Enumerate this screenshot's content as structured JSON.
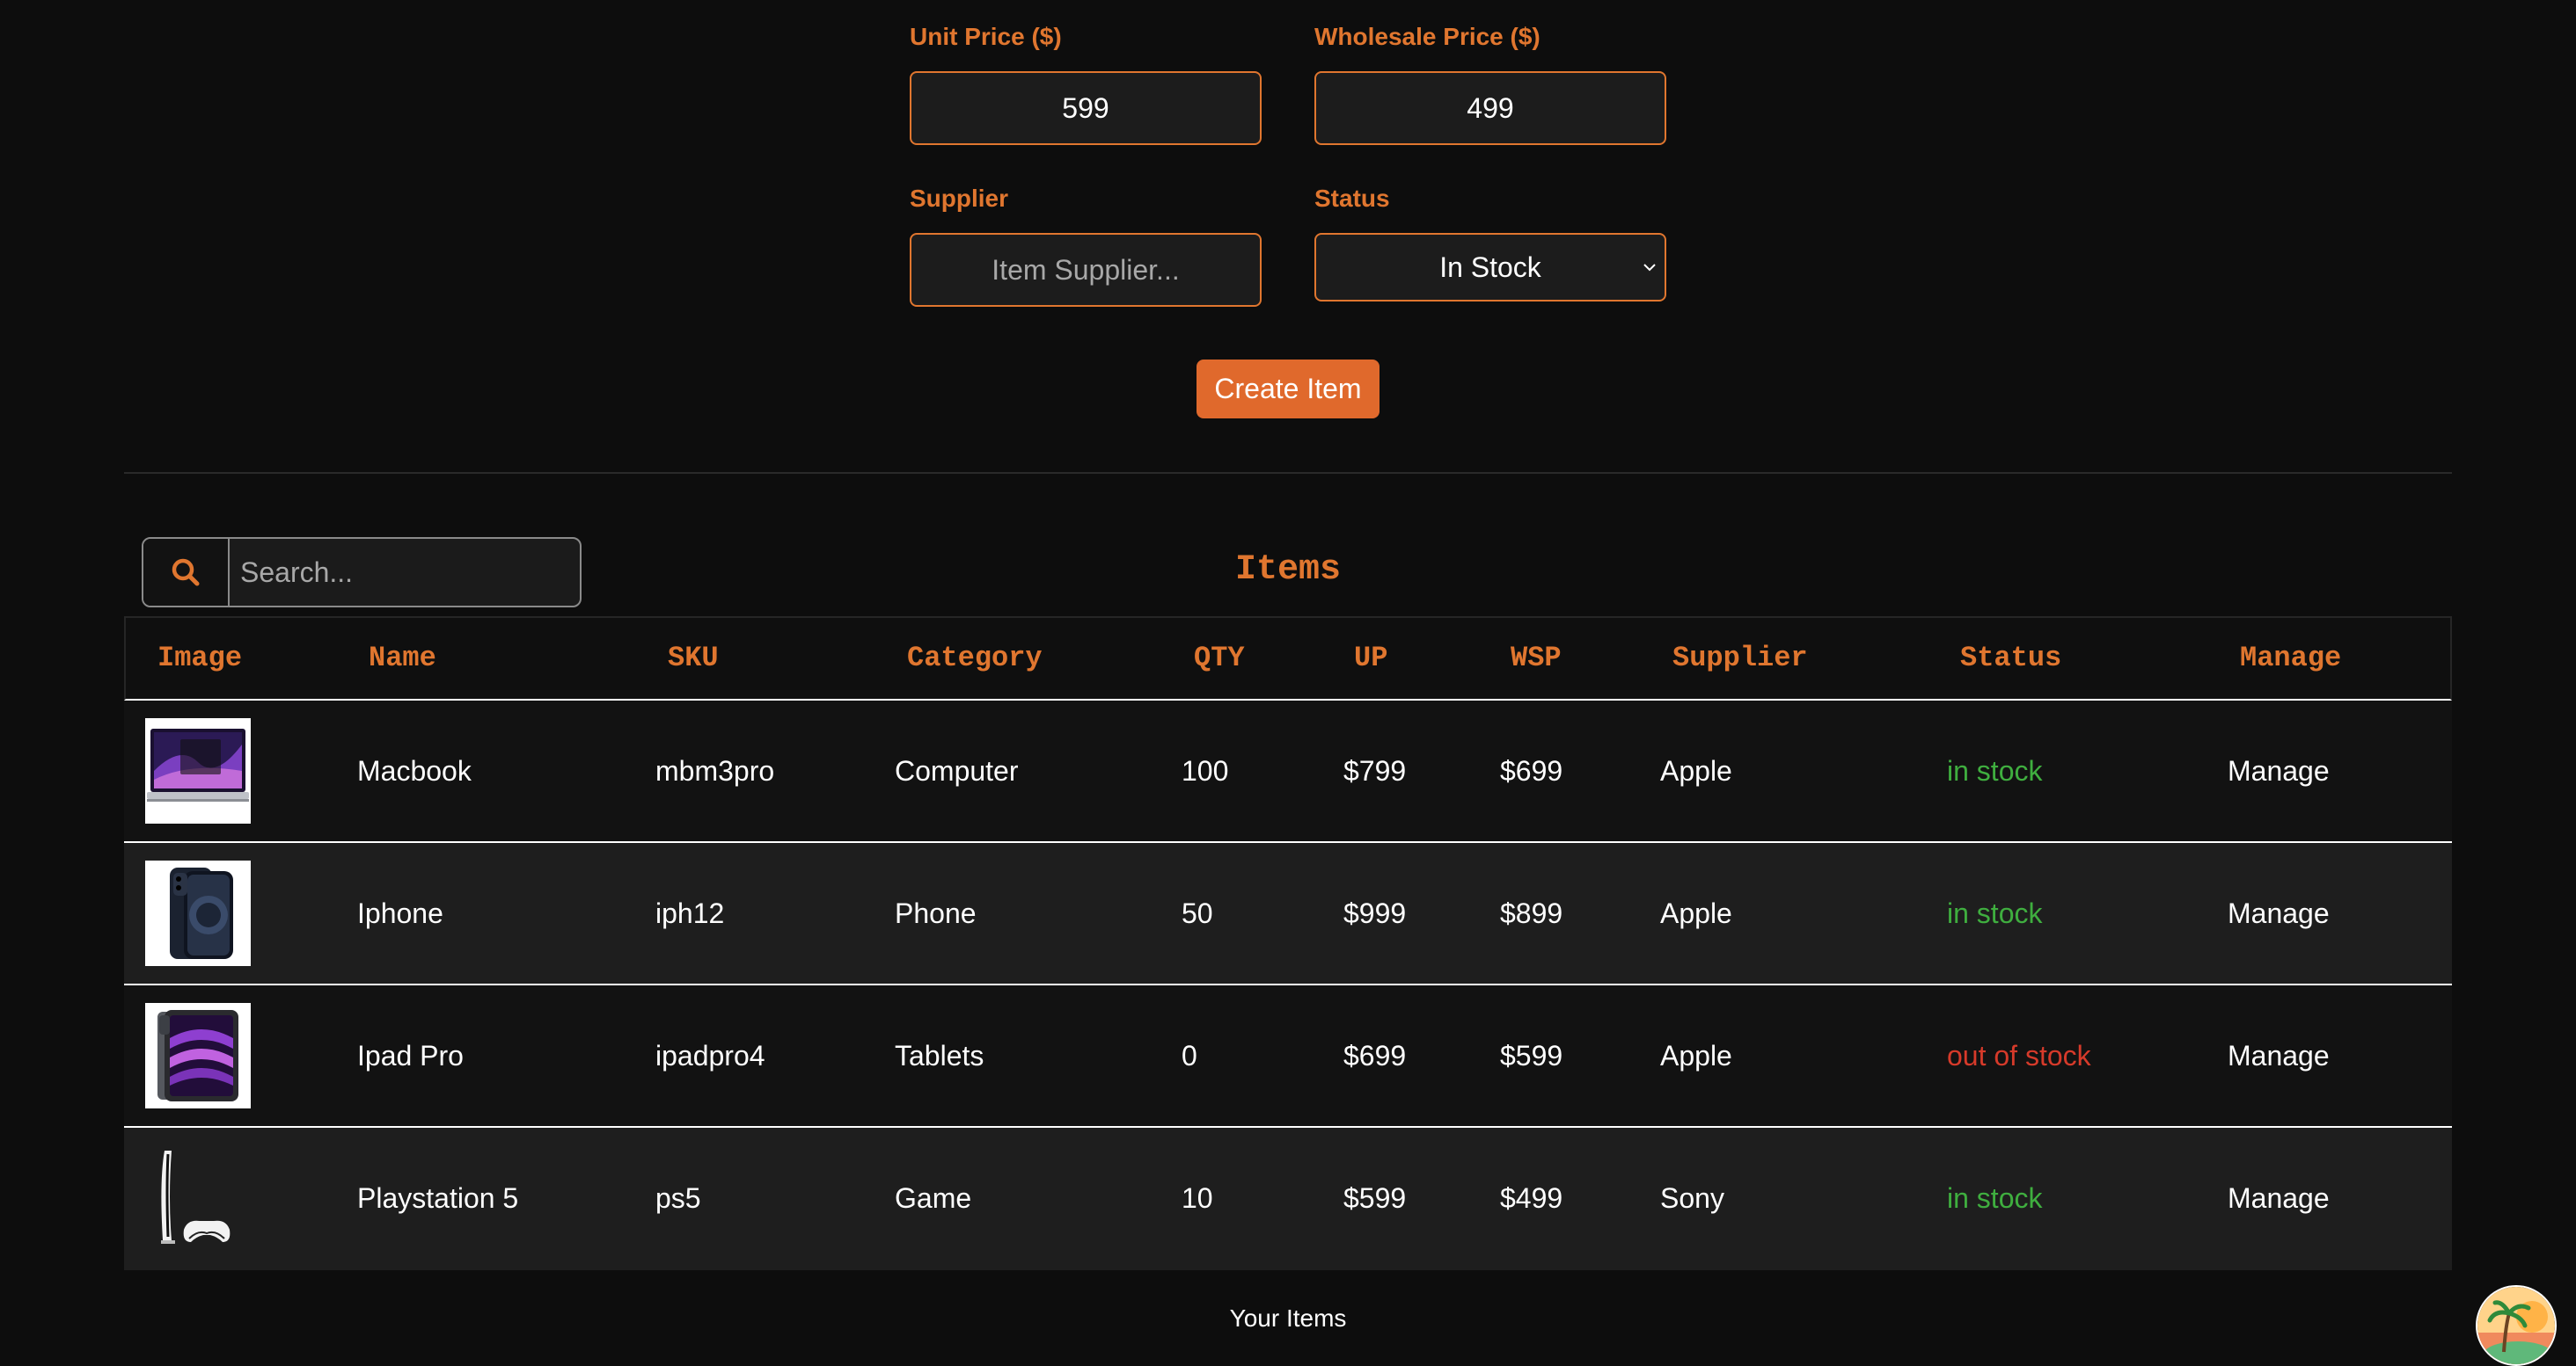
{
  "form": {
    "unit_price_label": "Unit Price ($)",
    "unit_price_value": "599",
    "wholesale_price_label": "Wholesale Price ($)",
    "wholesale_price_value": "499",
    "supplier_label": "Supplier",
    "supplier_placeholder": "Item Supplier...",
    "status_label": "Status",
    "status_selected": "In Stock",
    "create_button": "Create Item"
  },
  "search": {
    "icon": "search-icon",
    "placeholder": "Search..."
  },
  "items_title": "Items",
  "table": {
    "headers": [
      "Image",
      "Name",
      "SKU",
      "Category",
      "QTY",
      "UP",
      "WSP",
      "Supplier",
      "Status",
      "Manage"
    ],
    "rows": [
      {
        "image": "macbook-image",
        "name": "Macbook",
        "sku": "mbm3pro",
        "category": "Computer",
        "qty": "100",
        "up": "$799",
        "wsp": "$699",
        "supplier": "Apple",
        "status": "in stock",
        "manage": "Manage"
      },
      {
        "image": "iphone-image",
        "name": "Iphone",
        "sku": "iph12",
        "category": "Phone",
        "qty": "50",
        "up": "$999",
        "wsp": "$899",
        "supplier": "Apple",
        "status": "in stock",
        "manage": "Manage"
      },
      {
        "image": "ipad-image",
        "name": "Ipad Pro",
        "sku": "ipadpro4",
        "category": "Tablets",
        "qty": "0",
        "up": "$699",
        "wsp": "$599",
        "supplier": "Apple",
        "status": "out of stock",
        "manage": "Manage"
      },
      {
        "image": "playstation-image",
        "name": "Playstation 5",
        "sku": "ps5",
        "category": "Game",
        "qty": "10",
        "up": "$599",
        "wsp": "$499",
        "supplier": "Sony",
        "status": "in stock",
        "manage": "Manage"
      }
    ]
  },
  "footer": {
    "caption": "Your Items"
  },
  "colors": {
    "accent": "#e0762f",
    "button": "#e0692c",
    "in_stock": "#3fae3f",
    "out_of_stock": "#d63a2a",
    "background": "#0d0d0d"
  }
}
